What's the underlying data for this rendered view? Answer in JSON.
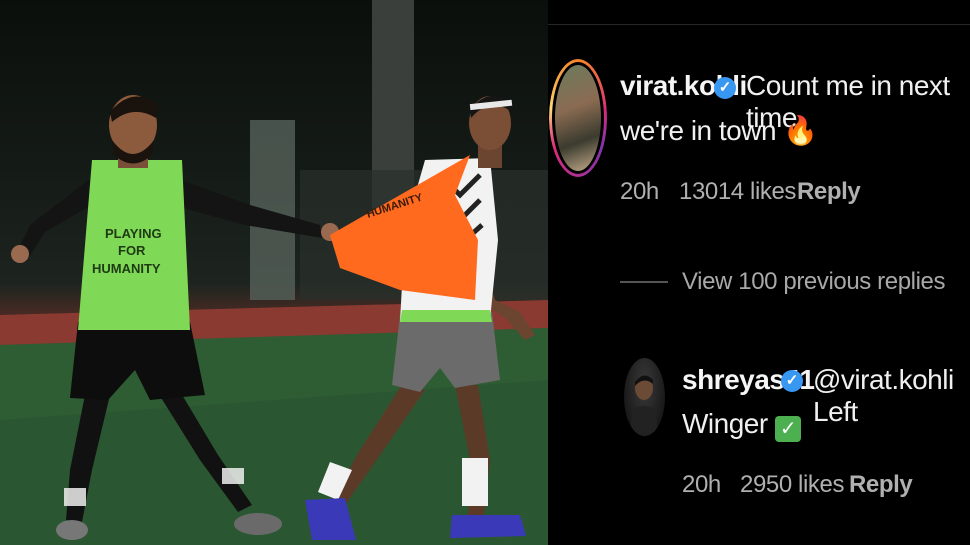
{
  "comments": [
    {
      "username": "virat.kohli",
      "text_line1": "Count me in next time",
      "text_line2": "we're in town",
      "emoji": "🔥",
      "time": "20h",
      "likes": "13014 likes",
      "reply_label": "Reply"
    },
    {
      "username": "shreyas41",
      "mention": "@virat.kohli Left",
      "text_line2": "Winger",
      "emoji": "✓",
      "time": "20h",
      "likes": "2950 likes",
      "reply_label": "Reply"
    }
  ],
  "view_replies": "View 100 previous replies",
  "bib_text": [
    "PLAYING",
    "FOR",
    "HUMANITY"
  ],
  "verified_icon": "✓",
  "colors": {
    "verified": "#3897f0",
    "green_bib": "#7ed957",
    "orange_bib": "#ff6a1f",
    "turf": "#2d5a34",
    "track": "#8b3a32"
  }
}
